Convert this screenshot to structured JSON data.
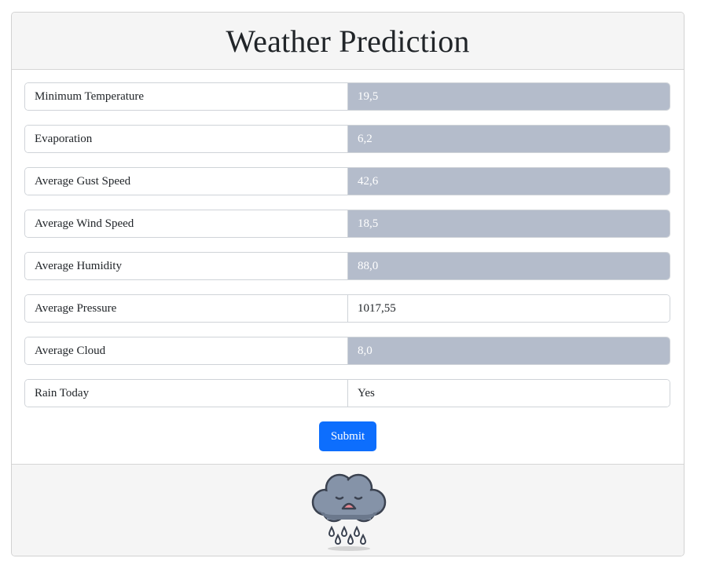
{
  "header": {
    "title": "Weather Prediction"
  },
  "form": {
    "fields": [
      {
        "label": "Minimum Temperature",
        "value": "19,5",
        "filled": true
      },
      {
        "label": "Evaporation",
        "value": "6,2",
        "filled": true
      },
      {
        "label": "Average Gust Speed",
        "value": "42,6",
        "filled": true
      },
      {
        "label": "Average Wind Speed",
        "value": "18,5",
        "filled": true
      },
      {
        "label": "Average Humidity",
        "value": "88,0",
        "filled": true
      },
      {
        "label": "Average Pressure",
        "value": "1017,55",
        "filled": false
      },
      {
        "label": "Average Cloud",
        "value": "8,0",
        "filled": true
      },
      {
        "label": "Rain Today",
        "value": "Yes",
        "filled": false
      }
    ],
    "submit_label": "Submit"
  },
  "footer": {
    "icon": "sad-rain-cloud-icon"
  },
  "colors": {
    "filled_input_bg": "#b4bccb",
    "submit_bg": "#0d6efd",
    "header_bg": "#f5f5f5"
  }
}
